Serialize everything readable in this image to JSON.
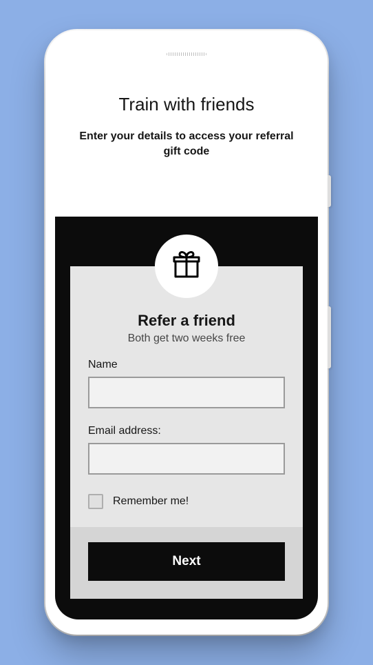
{
  "header": {
    "title": "Train with friends",
    "subtitle": "Enter your details to access your referral gift code"
  },
  "card": {
    "icon": "gift-icon",
    "title": "Refer a friend",
    "subtitle": "Both get two weeks free"
  },
  "form": {
    "name_label": "Name",
    "name_value": "",
    "email_label": "Email address:",
    "email_value": "",
    "remember_label": "Remember me!",
    "remember_checked": false
  },
  "actions": {
    "next_label": "Next"
  }
}
